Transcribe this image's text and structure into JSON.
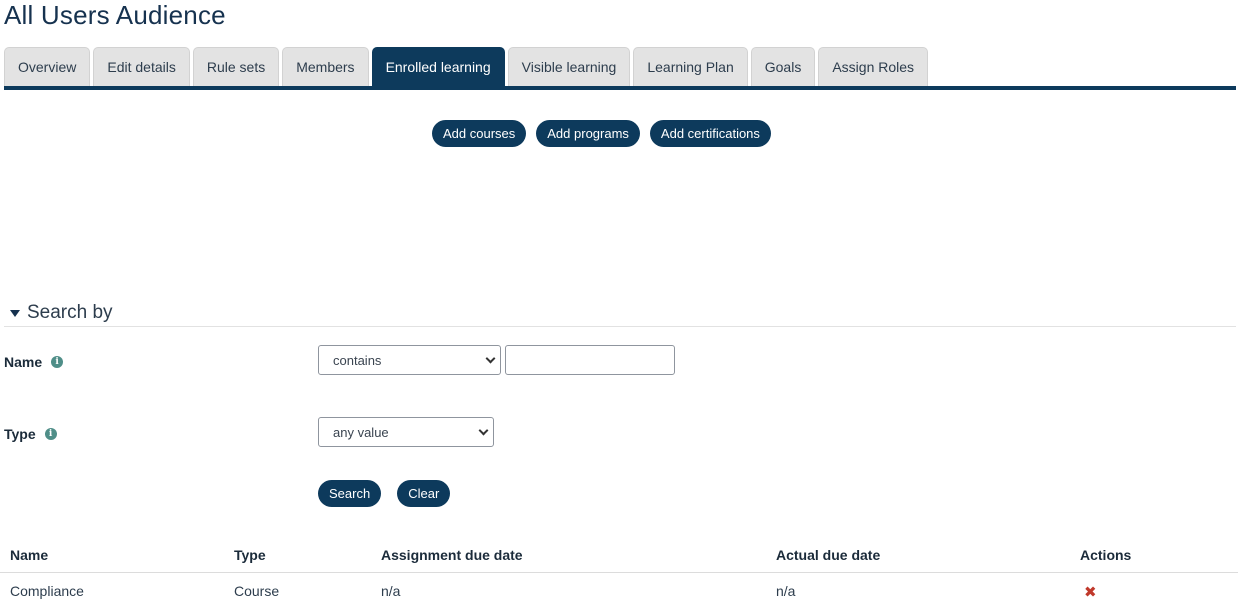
{
  "page": {
    "title": "All Users Audience"
  },
  "tabs": [
    {
      "label": "Overview",
      "active": false
    },
    {
      "label": "Edit details",
      "active": false
    },
    {
      "label": "Rule sets",
      "active": false
    },
    {
      "label": "Members",
      "active": false
    },
    {
      "label": "Enrolled learning",
      "active": true
    },
    {
      "label": "Visible learning",
      "active": false
    },
    {
      "label": "Learning Plan",
      "active": false
    },
    {
      "label": "Goals",
      "active": false
    },
    {
      "label": "Assign Roles",
      "active": false
    }
  ],
  "actions": {
    "add_courses": "Add courses",
    "add_programs": "Add programs",
    "add_certifications": "Add certifications"
  },
  "search": {
    "header": "Search by",
    "name_label": "Name",
    "name_operator": "contains",
    "name_value": "",
    "type_label": "Type",
    "type_value": "any value",
    "info_glyph": "i",
    "search_button": "Search",
    "clear_button": "Clear"
  },
  "table": {
    "columns": [
      "Name",
      "Type",
      "Assignment due date",
      "Actual due date",
      "Actions"
    ],
    "rows": [
      {
        "name": "Compliance",
        "type": "Course",
        "assignment_due": "n/a",
        "actual_due": "n/a",
        "action_icon": "delete-icon"
      }
    ]
  },
  "colors": {
    "primary": "#0d3a5c",
    "title": "#16324f",
    "info": "#4f8e88",
    "delete": "#c0392b"
  }
}
